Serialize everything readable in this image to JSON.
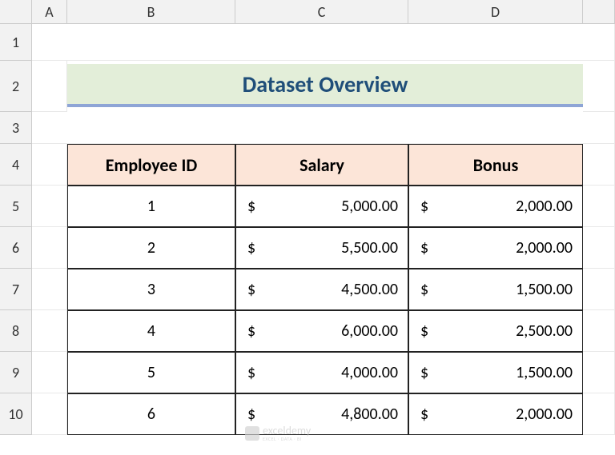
{
  "columns": [
    "A",
    "B",
    "C",
    "D"
  ],
  "rows": [
    "1",
    "2",
    "3",
    "4",
    "5",
    "6",
    "7",
    "8",
    "9",
    "10"
  ],
  "title": "Dataset Overview",
  "headers": {
    "b4": "Employee ID",
    "c4": "Salary",
    "d4": "Bonus"
  },
  "currency_symbol": "$",
  "data": [
    {
      "id": "1",
      "salary": "5,000.00",
      "bonus": "2,000.00"
    },
    {
      "id": "2",
      "salary": "5,500.00",
      "bonus": "2,000.00"
    },
    {
      "id": "3",
      "salary": "4,500.00",
      "bonus": "1,500.00"
    },
    {
      "id": "4",
      "salary": "6,000.00",
      "bonus": "2,500.00"
    },
    {
      "id": "5",
      "salary": "4,000.00",
      "bonus": "1,500.00"
    },
    {
      "id": "6",
      "salary": "4,800.00",
      "bonus": "2,000.00"
    }
  ],
  "watermark": {
    "name": "exceldemy",
    "sub": "EXCEL · DATA · BI"
  }
}
